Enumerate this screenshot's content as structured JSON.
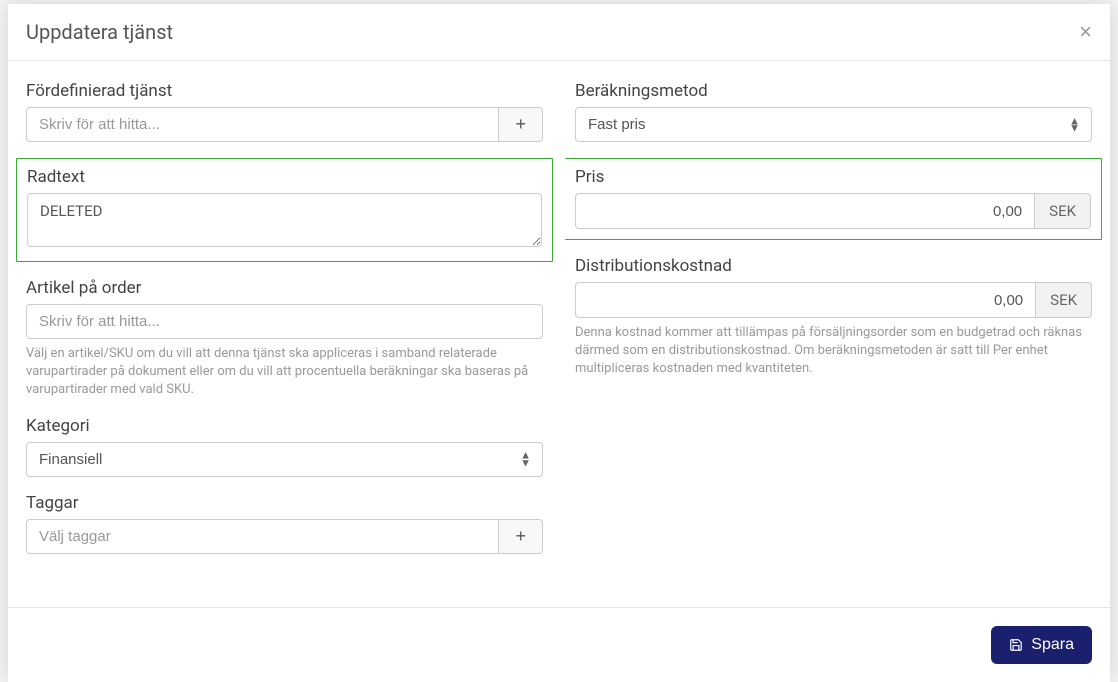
{
  "modal": {
    "title": "Uppdatera tjänst",
    "close_label": "×"
  },
  "predefined_service": {
    "label": "Fördefinierad tjänst",
    "placeholder": "Skriv för att hitta...",
    "add_btn": "+"
  },
  "calc_method": {
    "label": "Beräkningsmetod",
    "selected": "Fast pris"
  },
  "row_text": {
    "label": "Radtext",
    "value": "DELETED"
  },
  "price": {
    "label": "Pris",
    "value": "0,00",
    "currency": "SEK"
  },
  "article": {
    "label": "Artikel på order",
    "placeholder": "Skriv för att hitta...",
    "help": "Välj en artikel/SKU om du vill att denna tjänst ska appliceras i samband relaterade varupartirader på dokument eller om du vill att procentuella beräkningar ska baseras på varupartirader med vald SKU."
  },
  "distribution": {
    "label": "Distributionskostnad",
    "value": "0,00",
    "currency": "SEK",
    "help": "Denna kostnad kommer att tillämpas på försäljningsorder som en budgetrad och räknas därmed som en distributionskostnad. Om beräkningsmetoden är satt till Per enhet multipliceras kostnaden med kvantiteten."
  },
  "category": {
    "label": "Kategori",
    "selected": "Finansiell"
  },
  "tags": {
    "label": "Taggar",
    "placeholder": "Välj taggar",
    "add_btn": "+"
  },
  "footer": {
    "save": "Spara"
  }
}
